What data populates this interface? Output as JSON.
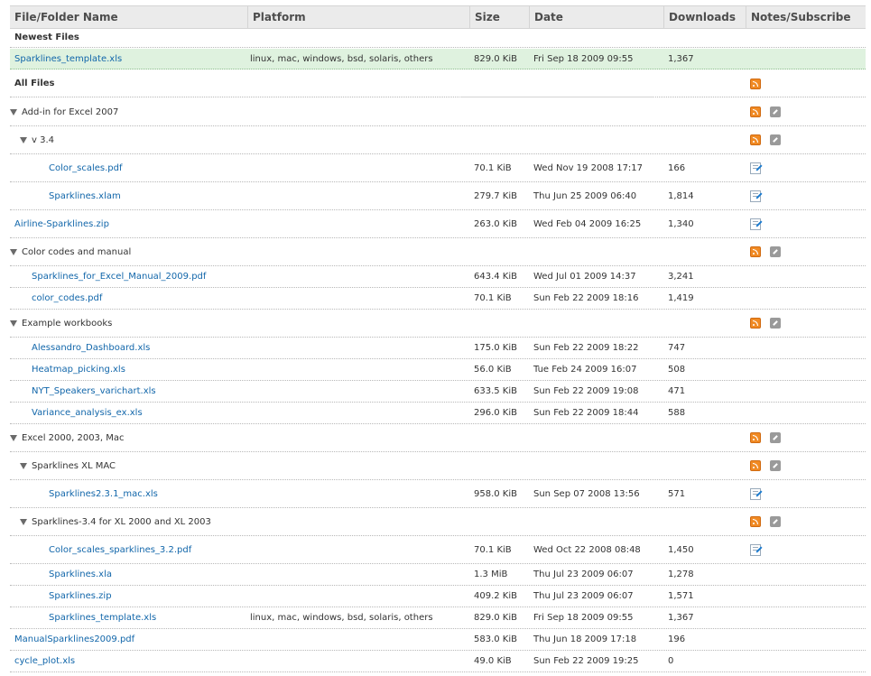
{
  "columns": {
    "name": "File/Folder Name",
    "platform": "Platform",
    "size": "Size",
    "date": "Date",
    "downloads": "Downloads",
    "notes": "Notes/Subscribe"
  },
  "sections": {
    "newest": "Newest Files",
    "all": "All Files"
  },
  "newest": {
    "name": "Sparklines_template.xls",
    "platform": "linux, mac, windows, bsd, solaris, others",
    "size": "829.0 KiB",
    "date": "Fri Sep 18 2009 09:55",
    "downloads": "1,367"
  },
  "rows": [
    {
      "type": "folder",
      "level": 0,
      "name": "Add-in for Excel 2007",
      "rss": true,
      "sub": true
    },
    {
      "type": "folder",
      "level": 1,
      "name": "v 3.4",
      "rss": true,
      "sub": true
    },
    {
      "type": "file",
      "level": 2,
      "name": "Color_scales.pdf",
      "platform": "",
      "size": "70.1 KiB",
      "date": "Wed Nov 19 2008 17:17",
      "downloads": "166",
      "note": true
    },
    {
      "type": "file",
      "level": 2,
      "name": "Sparklines.xlam",
      "platform": "",
      "size": "279.7 KiB",
      "date": "Thu Jun 25 2009 06:40",
      "downloads": "1,814",
      "note": true
    },
    {
      "type": "file",
      "level": 0,
      "name": "Airline-Sparklines.zip",
      "platform": "",
      "size": "263.0 KiB",
      "date": "Wed Feb 04 2009 16:25",
      "downloads": "1,340",
      "note": true
    },
    {
      "type": "folder",
      "level": 0,
      "name": "Color codes and manual",
      "rss": true,
      "sub": true
    },
    {
      "type": "file",
      "level": 1,
      "name": "Sparklines_for_Excel_Manual_2009.pdf",
      "platform": "",
      "size": "643.4 KiB",
      "date": "Wed Jul 01 2009 14:37",
      "downloads": "3,241"
    },
    {
      "type": "file",
      "level": 1,
      "name": "color_codes.pdf",
      "platform": "",
      "size": "70.1 KiB",
      "date": "Sun Feb 22 2009 18:16",
      "downloads": "1,419"
    },
    {
      "type": "folder",
      "level": 0,
      "name": "Example workbooks",
      "rss": true,
      "sub": true
    },
    {
      "type": "file",
      "level": 1,
      "name": "Alessandro_Dashboard.xls",
      "platform": "",
      "size": "175.0 KiB",
      "date": "Sun Feb 22 2009 18:22",
      "downloads": "747"
    },
    {
      "type": "file",
      "level": 1,
      "name": "Heatmap_picking.xls",
      "platform": "",
      "size": "56.0 KiB",
      "date": "Tue Feb 24 2009 16:07",
      "downloads": "508"
    },
    {
      "type": "file",
      "level": 1,
      "name": "NYT_Speakers_varichart.xls",
      "platform": "",
      "size": "633.5 KiB",
      "date": "Sun Feb 22 2009 19:08",
      "downloads": "471"
    },
    {
      "type": "file",
      "level": 1,
      "name": "Variance_analysis_ex.xls",
      "platform": "",
      "size": "296.0 KiB",
      "date": "Sun Feb 22 2009 18:44",
      "downloads": "588"
    },
    {
      "type": "folder",
      "level": 0,
      "name": "Excel 2000, 2003, Mac",
      "rss": true,
      "sub": true
    },
    {
      "type": "folder",
      "level": 1,
      "name": "Sparklines XL MAC",
      "rss": true,
      "sub": true
    },
    {
      "type": "file",
      "level": 2,
      "name": "Sparklines2.3.1_mac.xls",
      "platform": "",
      "size": "958.0 KiB",
      "date": "Sun Sep 07 2008 13:56",
      "downloads": "571",
      "note": true
    },
    {
      "type": "folder",
      "level": 1,
      "name": "Sparklines-3.4 for XL 2000 and XL 2003",
      "rss": true,
      "sub": true
    },
    {
      "type": "file",
      "level": 2,
      "name": "Color_scales_sparklines_3.2.pdf",
      "platform": "",
      "size": "70.1 KiB",
      "date": "Wed Oct 22 2008 08:48",
      "downloads": "1,450",
      "note": true
    },
    {
      "type": "file",
      "level": 2,
      "name": "Sparklines.xla",
      "platform": "",
      "size": "1.3 MiB",
      "date": "Thu Jul 23 2009 06:07",
      "downloads": "1,278"
    },
    {
      "type": "file",
      "level": 2,
      "name": "Sparklines.zip",
      "platform": "",
      "size": "409.2 KiB",
      "date": "Thu Jul 23 2009 06:07",
      "downloads": "1,571"
    },
    {
      "type": "file",
      "level": 2,
      "name": "Sparklines_template.xls",
      "platform": "linux, mac, windows, bsd, solaris, others",
      "size": "829.0 KiB",
      "date": "Fri Sep 18 2009 09:55",
      "downloads": "1,367"
    },
    {
      "type": "file",
      "level": 0,
      "name": "ManualSparklines2009.pdf",
      "platform": "",
      "size": "583.0 KiB",
      "date": "Thu Jun 18 2009 17:18",
      "downloads": "196"
    },
    {
      "type": "file",
      "level": 0,
      "name": "cycle_plot.xls",
      "platform": "",
      "size": "49.0 KiB",
      "date": "Sun Feb 22 2009 19:25",
      "downloads": "0"
    }
  ]
}
